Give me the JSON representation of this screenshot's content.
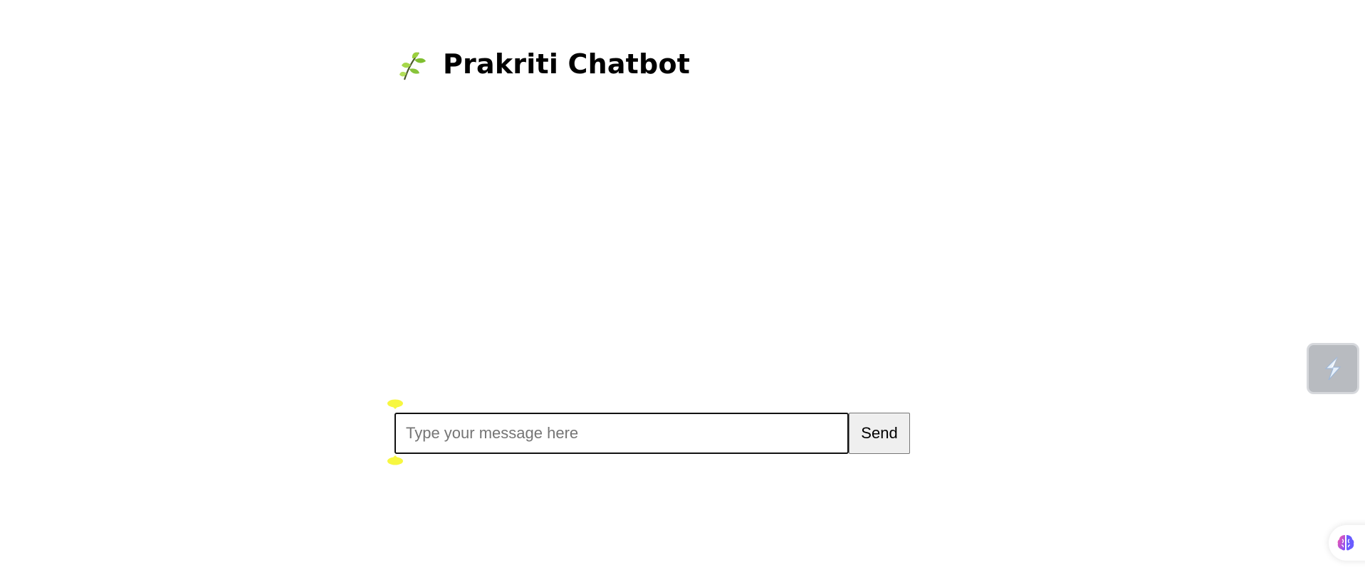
{
  "header": {
    "title": "Prakriti Chatbot",
    "icon": "leaf-icon"
  },
  "composer": {
    "input_placeholder": "Type your message here",
    "input_value": "",
    "send_label": "Send"
  },
  "overlays": {
    "side_widget_icon": "lightning-icon",
    "brain_tab_icon": "brain-icon"
  },
  "colors": {
    "background": "#ffffff",
    "leaf_green": "#8cc63f",
    "handle_yellow": "#f7f740",
    "side_widget_bg": "#b8bbc0"
  }
}
